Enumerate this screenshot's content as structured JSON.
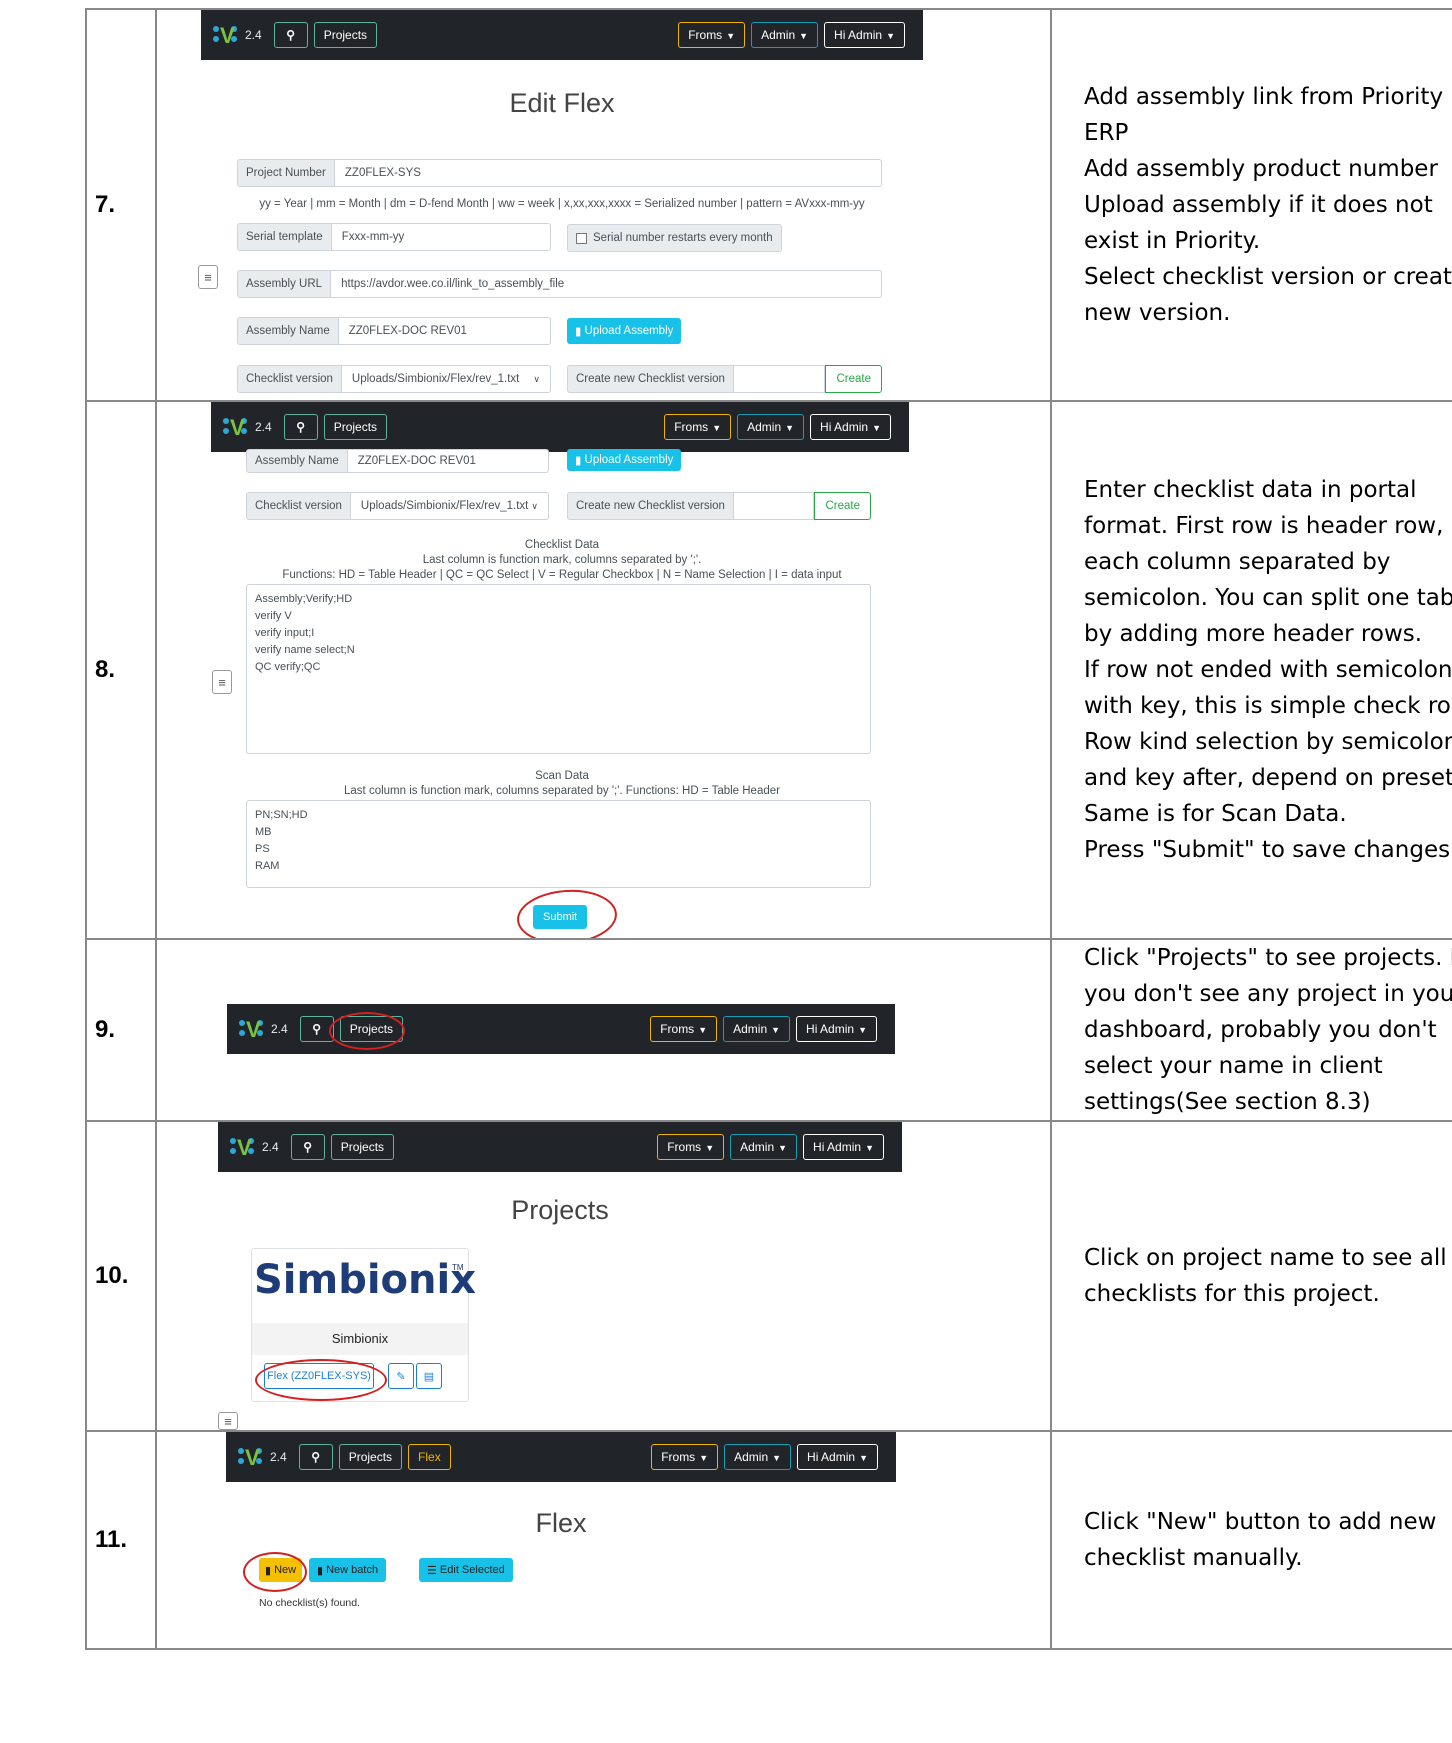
{
  "nav": {
    "version": "2.4",
    "projects": "Projects",
    "froms": "Froms",
    "admin": "Admin",
    "hi_admin": "Hi Admin",
    "flex": "Flex"
  },
  "rows": [
    {
      "num": "7.",
      "lines": [
        "Add assembly link from Priority ERP",
        "Add assembly product number",
        "Upload assembly if it does not exist in Priority.",
        "Select checklist version or create new version."
      ]
    },
    {
      "num": "8.",
      "lines": [
        "Enter checklist data in portal format. First row is header row, each column separated by semicolon. You can split one table by adding more header rows.",
        "If row not ended with semicolon with key, this is simple check row. Row kind selection by semicolon and key after, depend on preset.",
        "Same is for Scan Data.",
        "Press \"Submit\" to save changes."
      ]
    },
    {
      "num": "9.",
      "lines": [
        "Click \"Projects\" to see projects. If you don't see any project in your dashboard, probably you don't select your name in client settings(See section 8.3)"
      ]
    },
    {
      "num": "10.",
      "lines": [
        "Click on project name to see all checklists for this project."
      ]
    },
    {
      "num": "11.",
      "lines": [
        "Click \"New\" button to add new checklist manually."
      ]
    }
  ],
  "edit_flex": {
    "title": "Edit Flex",
    "project_number_label": "Project Number",
    "project_number": "ZZ0FLEX-SYS",
    "pattern_hint": "yy = Year | mm = Month | dm = D-fend Month | ww = week | x,xx,xxx,xxxx = Serialized number | pattern = AVxxx-mm-yy",
    "serial_template_label": "Serial template",
    "serial_template": "Fxxx-mm-yy",
    "serial_restart": "Serial number restarts every month",
    "assembly_url_label": "Assembly URL",
    "assembly_url": "https://avdor.wee.co.il/link_to_assembly_file",
    "assembly_name_label": "Assembly Name",
    "assembly_name": "ZZ0FLEX-DOC REV01",
    "upload_assembly": "Upload Assembly",
    "checklist_version_label": "Checklist version",
    "checklist_version": "Uploads/Simbionix/Flex/rev_1.txt",
    "create_new_label": "Create new Checklist version",
    "create": "Create"
  },
  "checklist": {
    "title": "Checklist Data",
    "hint1": "Last column is function mark, columns separated by ';'.",
    "hint2": "Functions: HD = Table Header | QC = QC Select | V = Regular Checkbox | N = Name Selection | I = data input",
    "lines": [
      "Assembly;Verify;HD",
      "verify V",
      "verify input;I",
      "verify name select;N",
      "QC verify;QC"
    ],
    "scan_title": "Scan Data",
    "scan_hint": "Last column is function mark, columns separated by ';'. Functions: HD = Table Header",
    "scan_lines": [
      "PN;SN;HD",
      "MB",
      "PS",
      "RAM"
    ],
    "submit": "Submit"
  },
  "projects_page": {
    "title": "Projects",
    "brand": "Simbionix",
    "tm": "TM",
    "card_name": "Simbionix",
    "flex_link": "Flex (ZZ0FLEX-SYS)"
  },
  "flex_page": {
    "title": "Flex",
    "new": "New",
    "new_batch": "New batch",
    "edit_selected": "Edit Selected",
    "no_found": "No checklist(s) found."
  },
  "colors": {
    "navbar": "#212529",
    "annotation_red": "#d32020",
    "info_button": "#17c1e8",
    "warning_button": "#f5c000"
  },
  "icons": [
    "search-icon",
    "caret-down-icon",
    "file-icon",
    "copy-icon",
    "list-icon",
    "edit-icon",
    "document-icon",
    "menu-icon",
    "logo-icon"
  ]
}
